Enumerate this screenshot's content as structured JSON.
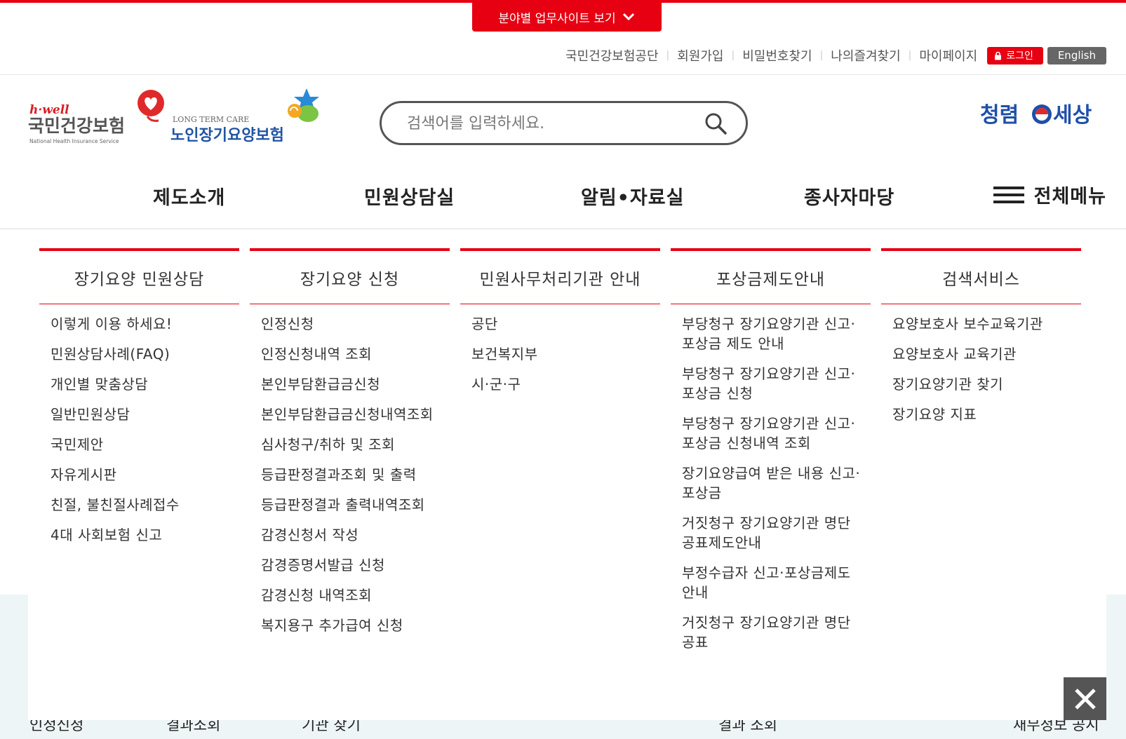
{
  "top": {
    "site_button": "분야별 업무사이트 보기",
    "links": [
      "국민건강보험공단",
      "회원가입",
      "비밀번호찾기",
      "나의즐겨찾기",
      "마이페이지"
    ],
    "login": "로그인",
    "english": "English"
  },
  "logos": {
    "nhis_brand": "h·well",
    "nhis_name": "국민건강보험",
    "nhis_en": "National Health Insurance Service",
    "ltc_en": "LONG TERM CARE",
    "ltc_name": "노인장기요양보험",
    "campaign_a": "청렴",
    "campaign_b": "세상"
  },
  "search": {
    "placeholder": "검색어를 입력하세요."
  },
  "gnb": {
    "items": [
      "제도소개",
      "민원상담실",
      "알림•자료실",
      "종사자마당"
    ],
    "all_menu": "전체메뉴"
  },
  "menu": {
    "columns": [
      {
        "title": "장기요양 민원상담",
        "items": [
          "이렇게 이용 하세요!",
          "민원상담사례(FAQ)",
          "개인별 맞춤상담",
          "일반민원상담",
          "국민제안",
          "자유게시판",
          "친절, 불친절사례접수",
          "4대 사회보험 신고"
        ]
      },
      {
        "title": "장기요양 신청",
        "items": [
          "인정신청",
          "인정신청내역 조회",
          "본인부담환급금신청",
          "본인부담환급금신청내역조회",
          "심사청구/취하 및 조회",
          "등급판정결과조회 및 출력",
          "등급판정결과 출력내역조회",
          "감경신청서 작성",
          "감경증명서발급 신청",
          "감경신청 내역조회",
          "복지용구 추가급여 신청"
        ]
      },
      {
        "title": "민원사무처리기관 안내",
        "items": [
          "공단",
          "보건복지부",
          "시·군·구"
        ]
      },
      {
        "title": "포상금제도안내",
        "items": [
          "부당청구 장기요양기관 신고·포상금 제도 안내",
          "부당청구 장기요양기관 신고·포상금 신청",
          "부당청구 장기요양기관 신고·포상금 신청내역 조회",
          "장기요양급여 받은 내용 신고·포상금",
          "거짓청구 장기요양기관 명단 공표제도안내",
          "부정수급자 신고·포상금제도 안내",
          "거짓청구 장기요양기관 명단 공표"
        ]
      },
      {
        "title": "검색서비스",
        "items": [
          "요양보호사 보수교육기관",
          "요양보호사 교육기관",
          "장기요양기관 찾기",
          "장기요양 지표"
        ]
      }
    ]
  },
  "background_peek": [
    "인정신청",
    "결과조회",
    "기관 찾기",
    "결과 조회",
    "재무정보 공시"
  ],
  "colors": {
    "accent": "#e60012",
    "dark_button": "#555555",
    "english_button": "#666666",
    "band": "#eef5f6"
  }
}
